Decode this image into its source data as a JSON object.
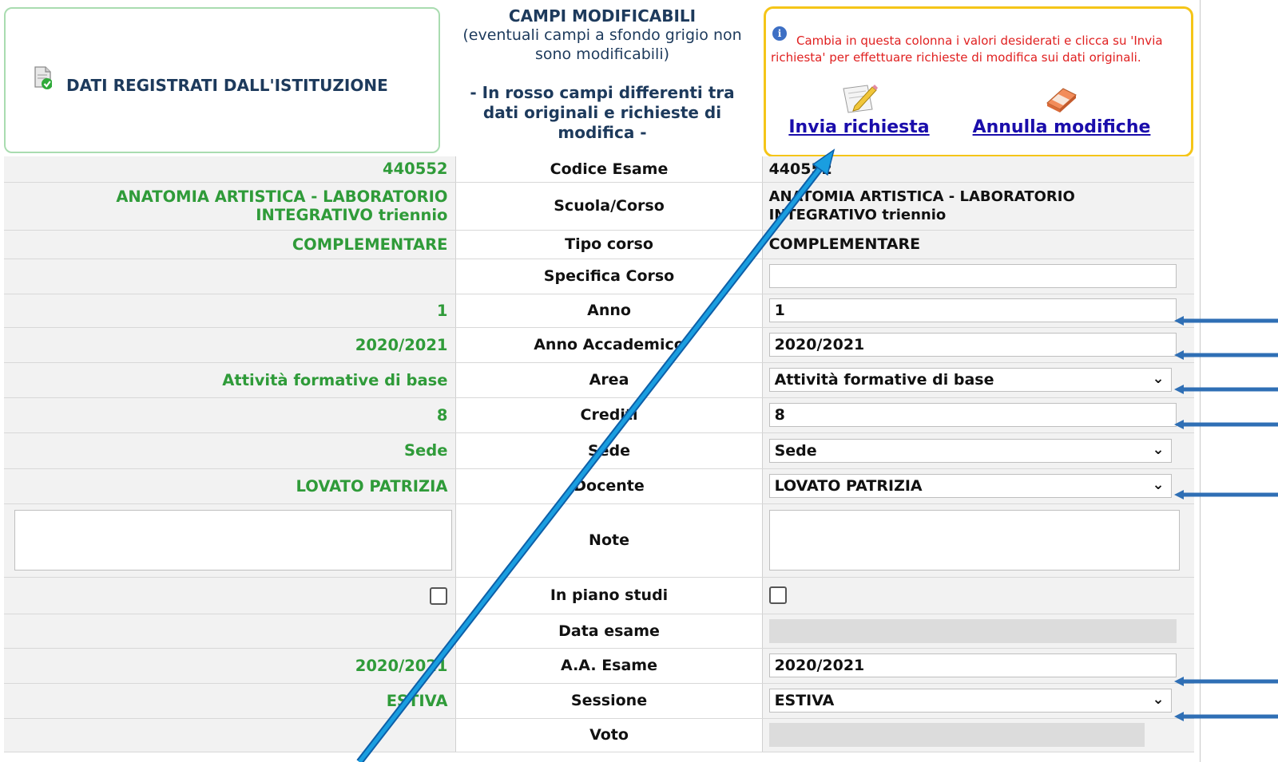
{
  "header": {
    "left_title": "DATI REGISTRATI DALL'ISTITUZIONE",
    "mid_title": "CAMPI MODIFICABILI",
    "mid_subtitle": "(eventuali campi a sfondo grigio non sono modificabili)",
    "mid_note": "- In rosso campi differenti tra dati originali e richieste di modifica -",
    "info_text": "Cambia in questa colonna i valori desiderati e clicca su 'Invia richiesta' per effettuare richieste di modifica sui dati originali.",
    "send_label": "Invia richiesta",
    "undo_label": "Annulla modifiche"
  },
  "rows": {
    "codice": {
      "label": "Codice Esame",
      "original": "440552",
      "value": "440552"
    },
    "scuola": {
      "label": "Scuola/Corso",
      "original_l1": "ANATOMIA ARTISTICA - LABORATORIO",
      "original_l2": "INTEGRATIVO triennio",
      "value_l1": "ANATOMIA ARTISTICA - LABORATORIO",
      "value_l2": "INTEGRATIVO triennio"
    },
    "tipo": {
      "label": "Tipo corso",
      "original": "COMPLEMENTARE",
      "value": "COMPLEMENTARE"
    },
    "specifica": {
      "label": "Specifica Corso",
      "value": ""
    },
    "anno": {
      "label": "Anno",
      "original": "1",
      "value": "1"
    },
    "anno_acc": {
      "label": "Anno Accademico",
      "original": "2020/2021",
      "value": "2020/2021"
    },
    "area": {
      "label": "Area",
      "original": "Attività formative di base",
      "value": "Attività formative di base"
    },
    "crediti": {
      "label": "Crediti",
      "original": "8",
      "value": "8"
    },
    "sede": {
      "label": "Sede",
      "original": "Sede",
      "value": "Sede"
    },
    "docente": {
      "label": "Docente",
      "original": "LOVATO PATRIZIA",
      "value": "LOVATO PATRIZIA"
    },
    "note": {
      "label": "Note"
    },
    "piano": {
      "label": "In piano studi"
    },
    "data_esame": {
      "label": "Data esame"
    },
    "aa_esame": {
      "label": "A.A. Esame",
      "original": "2020/2021",
      "value": "2020/2021"
    },
    "sessione": {
      "label": "Sessione",
      "original": "ESTIVA",
      "value": "ESTIVA"
    },
    "voto": {
      "label": "Voto"
    }
  },
  "icons": {
    "document": "document-check-icon",
    "info": "info-icon",
    "send": "pencil-paper-icon",
    "undo": "eraser-icon",
    "dropdown": "chevron-down-icon",
    "annotation": "arrow-icon"
  },
  "colors": {
    "original_text": "#2f9b39",
    "info_text": "#e02020",
    "link": "#1a0dab",
    "header_left_border": "#a9dcb0",
    "header_right_border": "#f5c518",
    "arrow": "#2f6fb5",
    "diagonal_arrow": "#1a9ee0"
  }
}
